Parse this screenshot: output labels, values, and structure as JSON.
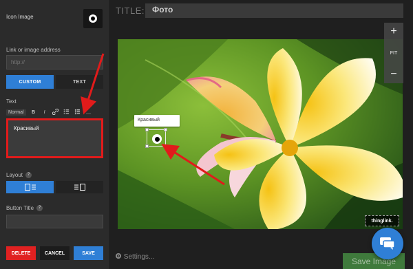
{
  "left_panel": {
    "icon_image_label": "Icon Image",
    "link_label": "Link or image address",
    "link_placeholder": "http://",
    "mode_options": [
      "CUSTOM",
      "TEXT"
    ],
    "text_label": "Text",
    "toolbar": {
      "style_select": "Normal",
      "bold": "B",
      "italic": "I"
    },
    "text_value": "Красивый",
    "layout_label": "Layout",
    "help_badge": "?",
    "button_title_label": "Button Title",
    "actions": {
      "delete": "DELETE",
      "cancel": "CANCEL",
      "save": "SAVE"
    }
  },
  "editor": {
    "title_prefix": "TITLE:",
    "title_value": "Фото",
    "zoom": {
      "fit": "FIT"
    },
    "tag_label": "Красивый",
    "watermark": "thinglink.",
    "settings_label": "Settings...",
    "save_image_label": "Save Image"
  },
  "colors": {
    "accent_blue": "#2f7fd6",
    "delete_red": "#e02121",
    "highlight_red": "#e11b1b",
    "save_green": "#3f7a3c"
  },
  "icons": [
    "gear-icon",
    "chat-icon",
    "zoom-in-icon",
    "zoom-out-icon",
    "link-icon",
    "list-icon",
    "bullets-icon",
    "image-left-layout-icon",
    "image-right-layout-icon"
  ]
}
